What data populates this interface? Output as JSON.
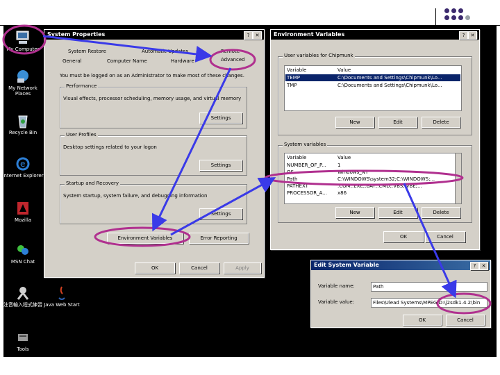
{
  "desktop": {
    "icons": [
      {
        "label": "My Computer",
        "icon": "computer-icon"
      },
      {
        "label": "My Network Places",
        "icon": "network-icon"
      },
      {
        "label": "Recycle Bin",
        "icon": "recycle-bin-icon"
      },
      {
        "label": "Internet Explorer",
        "icon": "ie-icon"
      },
      {
        "label": "Mozilla",
        "icon": "mozilla-icon"
      },
      {
        "label": "MSN Chat",
        "icon": "msn-icon"
      },
      {
        "label": "注音輸入程式練習",
        "icon": "input-icon"
      },
      {
        "label": "Java Web Start",
        "icon": "java-icon"
      },
      {
        "label": "Tools",
        "icon": "tools-icon"
      }
    ]
  },
  "system_properties": {
    "title": "System Properties",
    "tabs_row1": [
      "System Restore",
      "Automatic Updates",
      "Remote"
    ],
    "tabs_row2": [
      "General",
      "Computer Name",
      "Hardware",
      "Advanced"
    ],
    "admin_note": "You must be logged on as an Administrator to make most of these changes.",
    "performance": {
      "label": "Performance",
      "desc": "Visual effects, processor scheduling, memory usage, and virtual memory",
      "button": "Settings"
    },
    "user_profiles": {
      "label": "User Profiles",
      "desc": "Desktop settings related to your logon",
      "button": "Settings"
    },
    "startup": {
      "label": "Startup and Recovery",
      "desc": "System startup, system failure, and debugging information",
      "button": "Settings"
    },
    "env_button": "Environment Variables",
    "error_button": "Error Reporting",
    "ok": "OK",
    "cancel": "Cancel",
    "apply": "Apply"
  },
  "env_vars": {
    "title": "Environment Variables",
    "user_group": "User variables for Chipmunk",
    "col_var": "Variable",
    "col_val": "Value",
    "user_rows": [
      {
        "var": "TEMP",
        "val": "C:\\Documents and Settings\\Chipmunk\\Lo..."
      },
      {
        "var": "TMP",
        "val": "C:\\Documents and Settings\\Chipmunk\\Lo..."
      }
    ],
    "system_group": "System variables",
    "system_rows": [
      {
        "var": "NUMBER_OF_P...",
        "val": "1"
      },
      {
        "var": "OS",
        "val": "Windows_NT"
      },
      {
        "var": "Path",
        "val": "C:\\WINDOWS\\system32;C:\\WINDOWS;..."
      },
      {
        "var": "PATHEXT",
        "val": ".COM;.EXE;.BAT;.CMD;.VBS;.VBE;..."
      },
      {
        "var": "PROCESSOR_A...",
        "val": "x86"
      }
    ],
    "new": "New",
    "edit": "Edit",
    "delete": "Delete",
    "ok": "OK",
    "cancel": "Cancel"
  },
  "edit_var": {
    "title": "Edit System Variable",
    "name_label": "Variable name:",
    "name_value": "Path",
    "value_label": "Variable value:",
    "value_value": "Files\\Ulead Systems\\MPEG;D:\\j2sdk1.4.2\\bin",
    "ok": "OK",
    "cancel": "Cancel"
  },
  "colors": {
    "highlight": "#b0308f",
    "arrow": "#3a3ae8",
    "titlebar": "#0a246a"
  }
}
